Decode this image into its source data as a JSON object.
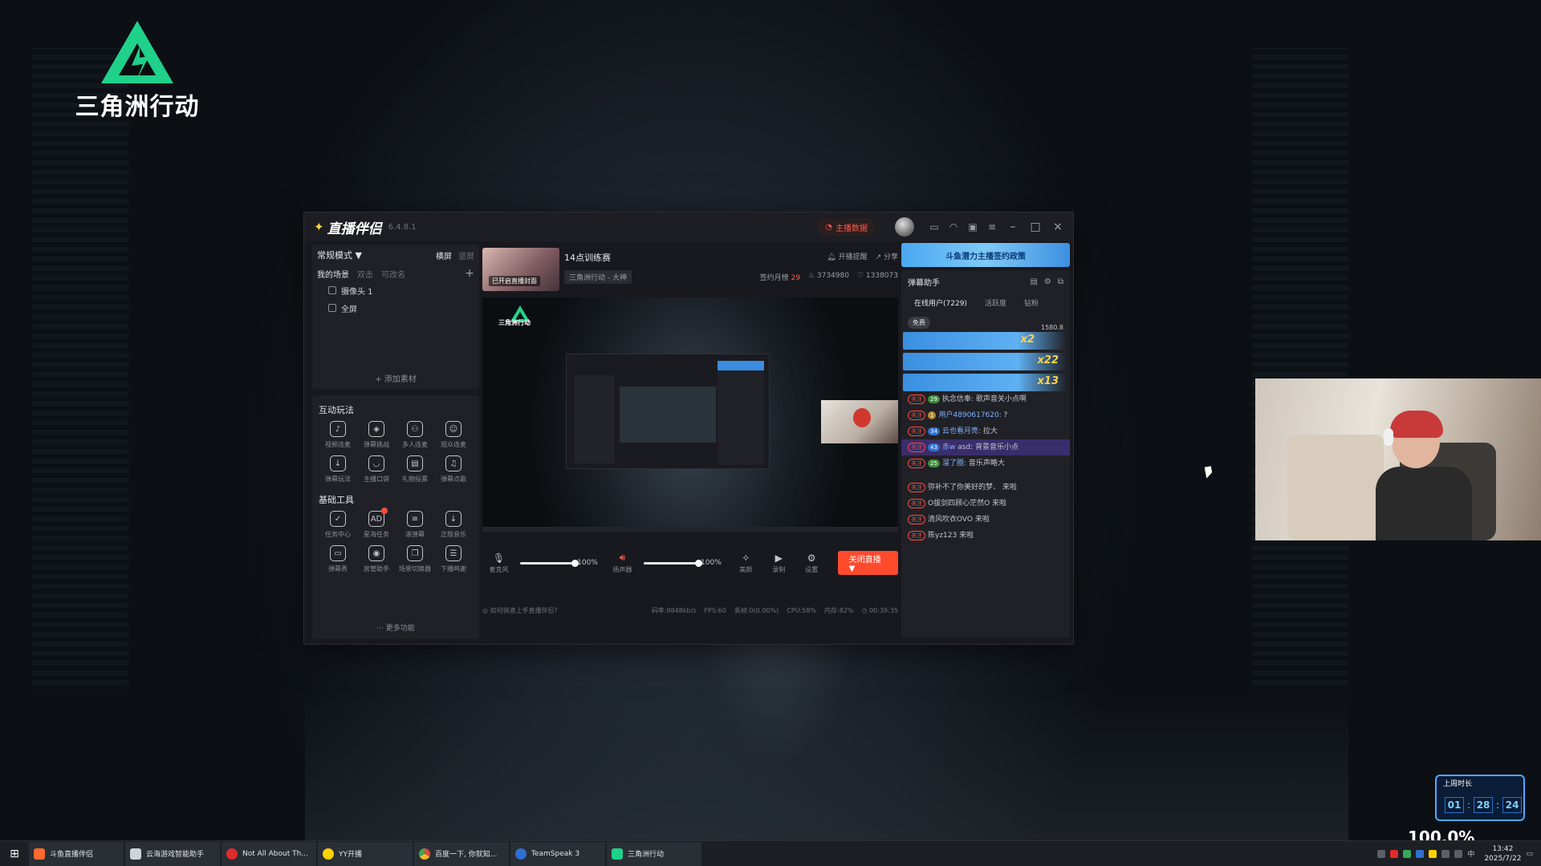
{
  "game": {
    "logo_title": "三角洲行动"
  },
  "app": {
    "brand": "直播伴侣",
    "version": "6.4.8.1",
    "anchor_data_label": "主播数据",
    "left": {
      "mode_label": "常规模式 ▼",
      "mode_tabs": [
        "横屏",
        "竖屏"
      ],
      "scene_tabs": [
        "我的场景",
        "双击",
        "可改名"
      ],
      "sources": [
        "摄像头 1",
        "全屏"
      ],
      "add_source": "+ 添加素材",
      "interactive_title": "互动玩法",
      "interactive_tools": [
        "视频连麦",
        "弹幕挑战",
        "多人连麦",
        "观众连麦",
        "弹幕玩法",
        "主播口袋",
        "礼物投票",
        "弹幕点歌"
      ],
      "basic_title": "基础工具",
      "basic_tools": [
        "任务中心",
        "星海任务",
        "滚弹幕",
        "正版音乐",
        "弹幕秀",
        "房管助手",
        "场景切换器",
        "下播鸣谢"
      ],
      "more_tools": "··· 更多功能"
    },
    "center": {
      "cover_label": "已开启直播封面",
      "stream_title": "14点训练赛",
      "category": "三角洲行动 - 大神",
      "actions": [
        "开播提醒",
        "分享"
      ],
      "stats": {
        "sign_label": "签约月榜",
        "sign_value": "29",
        "heat": "3734980",
        "likes": "1338073"
      },
      "mic_label": "麦克风",
      "mic_volume": "100%",
      "speaker_label": "扬声器",
      "speaker_volume": "100%",
      "beauty_label": "美颜",
      "record_label": "录制",
      "settings_label": "设置",
      "stop_label": "关闭直播 ▼",
      "status": {
        "help": "如何快速上手直播伴侣?",
        "bitrate": "码率:9848kb/s",
        "fps": "FPS:60",
        "dropped": "丢帧:0(0.00%)",
        "cpu": "CPU:58%",
        "memory": "内存:82%",
        "duration": "00:39:35"
      },
      "preview_logo_text": "三角洲行动"
    },
    "right": {
      "promo": "斗鱼潜力主播签约政策",
      "chat_title": "弹幕助手",
      "chat_tabs": [
        "在线用户(7229)",
        "活跃度",
        "钻粉"
      ],
      "free_chip": "免费",
      "gift_count_1": "x2",
      "gift_count_2": "x22",
      "gift_count_3": "x13",
      "side_number": "1580.8",
      "messages": [
        {
          "tag": "关注",
          "lvl": "29",
          "user": "",
          "text": "执念信奉: 歌声音关小点啊"
        },
        {
          "tag": "关注",
          "lvl": "1",
          "user": "用户4890617620:",
          "text": "?"
        },
        {
          "tag": "关注",
          "lvl": "34",
          "user": "云也看月亮:",
          "text": "拉大"
        },
        {
          "tag": "关注",
          "lvl": "43",
          "user": "赤w",
          "text": "asd: 背景音乐小点"
        },
        {
          "tag": "关注",
          "lvl": "25",
          "user": "溜了圈:",
          "text": "音乐声略大"
        }
      ],
      "entries": [
        {
          "tag": "关注",
          "text": "弥补不了你美好的梦、 来啦"
        },
        {
          "tag": "关注",
          "text": "O拔剑四顾心茫然O 来啦"
        },
        {
          "tag": "关注",
          "text": "清风吹衣OVO 来啦"
        },
        {
          "tag": "关注",
          "text": "陈yz123 来啦"
        }
      ]
    }
  },
  "uptime": {
    "label": "上周时长",
    "h": "01",
    "m": "28",
    "s": "24"
  },
  "overlay_percent": "100.0%",
  "taskbar": {
    "items": [
      "斗鱼直播伴侣",
      "云海游戏智能助手",
      "Not All About Th...",
      "YY开播",
      "百度一下, 你就知...",
      "TeamSpeak 3",
      "三角洲行动"
    ],
    "time": "13:42",
    "date": "2025/7/22",
    "ime": "中"
  }
}
